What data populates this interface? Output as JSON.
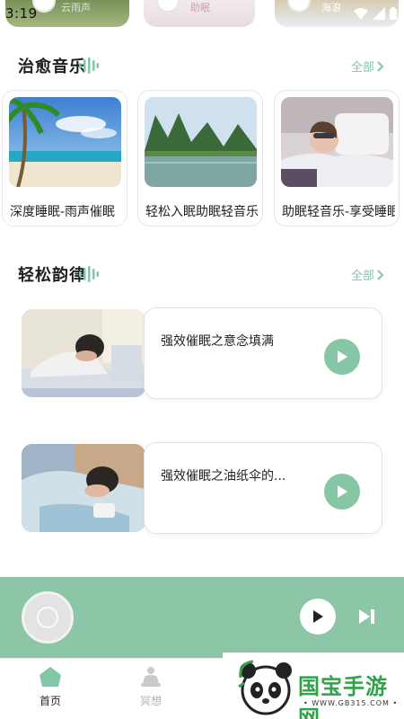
{
  "status_bar": {
    "time": "3:19"
  },
  "top_cards": {
    "card1_text": "云雨声",
    "card2_text": "助眠",
    "card3_text": "海浪"
  },
  "sections": {
    "healing_music": {
      "title": "治愈音乐",
      "see_all": "全部"
    },
    "relaxing_rhythm": {
      "title": "轻松韵律",
      "see_all": "全部"
    }
  },
  "music_cards": [
    {
      "title": "深度睡眠-雨声催眠",
      "image": "beach-palm-scene"
    },
    {
      "title": "轻松入眠助眠轻音乐",
      "image": "karst-lake-scene"
    },
    {
      "title": "助眠轻音乐-享受睡眠",
      "image": "sleeping-woman-eye-mask"
    }
  ],
  "rhythm_items": [
    {
      "title": "强效催眠之意念填满",
      "image": "man-sleeping-on-desk"
    },
    {
      "title": "强效催眠之油纸伞的...",
      "image": "boy-sleeping-in-bed"
    }
  ],
  "player": {
    "state": "paused"
  },
  "tabs": [
    {
      "label": "首页",
      "icon": "home-icon",
      "active": true
    },
    {
      "label": "冥想",
      "icon": "meditation-icon",
      "active": false
    }
  ],
  "watermark": {
    "brand": "国宝手游网",
    "url": "• WWW.GB315.COM •"
  },
  "colors": {
    "accent": "#86c6a4",
    "player_bar": "#8cc6a6",
    "see_all": "#7fc7a6",
    "active_tab": "#7fc7a6"
  }
}
